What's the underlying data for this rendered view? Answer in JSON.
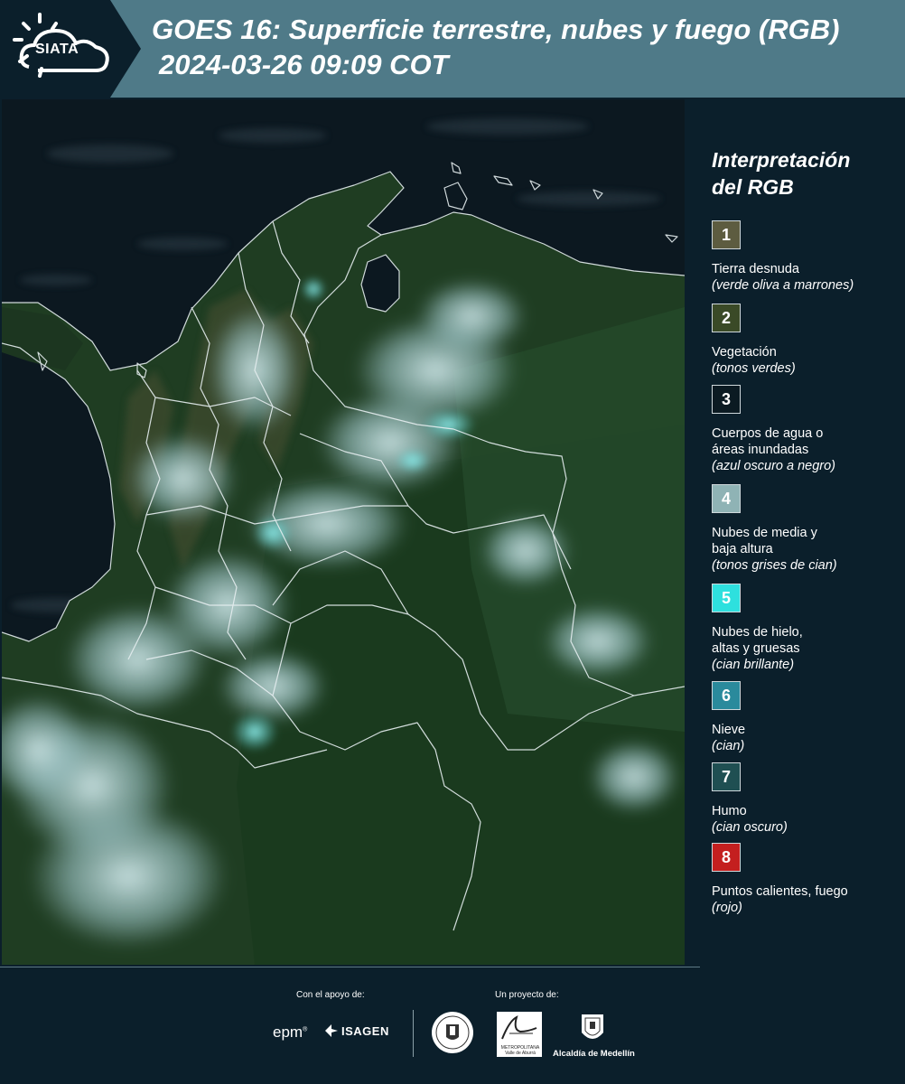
{
  "header": {
    "logo_text": "SIATA",
    "title_line1": "GOES 16: Superficie terrestre, nubes y fuego (RGB)",
    "title_line2": "2024-03-26 09:09 COT"
  },
  "legend": {
    "title_line1": "Interpretación",
    "title_line2": "del RGB",
    "items": [
      {
        "number": "1",
        "label_lines": [
          "Tierra desnuda"
        ],
        "sub": "(verde oliva a marrones)",
        "color": "#5d5c40"
      },
      {
        "number": "2",
        "label_lines": [
          "Vegetación"
        ],
        "sub": "(tonos verdes)",
        "color": "#3a4a27"
      },
      {
        "number": "3",
        "label_lines": [
          "Cuerpos de agua o",
          "áreas inundadas"
        ],
        "sub": "(azul oscuro a negro)",
        "color": "#0b1a22"
      },
      {
        "number": "4",
        "label_lines": [
          "Nubes de media y",
          "baja altura"
        ],
        "sub": "(tonos grises de cian)",
        "color": "#8fb3b5"
      },
      {
        "number": "5",
        "label_lines": [
          "Nubes de hielo,",
          "altas y gruesas"
        ],
        "sub": "(cian brillante)",
        "color": "#2ee0de"
      },
      {
        "number": "6",
        "label_lines": [
          "Nieve"
        ],
        "sub": "(cian)",
        "color": "#2a8a9c"
      },
      {
        "number": "7",
        "label_lines": [
          "Humo"
        ],
        "sub": "(cian oscuro)",
        "color": "#1f4f52"
      },
      {
        "number": "8",
        "label_lines": [
          "Puntos calientes, fuego"
        ],
        "sub": "(rojo)",
        "color": "#c41f1f"
      }
    ]
  },
  "footer": {
    "support_label": "Con el apoyo de:",
    "project_label": "Un proyecto de:",
    "epm": "epm",
    "isagen": "ISAGEN",
    "area_line1": "METROPOLITANA",
    "area_line2": "Valle de Aburrá",
    "medellin": "Alcaldía de Medellín"
  }
}
